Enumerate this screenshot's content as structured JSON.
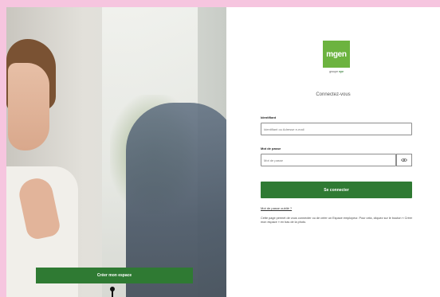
{
  "left_panel": {
    "create_button_label": "Créer mon espace"
  },
  "logo": {
    "text": "mgen",
    "subtitle_prefix": "groupe",
    "subtitle_brand": "vyv"
  },
  "form": {
    "heading": "Connectez-vous",
    "identifier_label": "Identifiant",
    "identifier_placeholder": "Identifiant ou Adresse e-mail",
    "password_label": "Mot de passe",
    "password_placeholder": "Mot de passe",
    "show_password_icon": "eye-icon",
    "login_button_label": "Se connecter",
    "forgot_link": "Mot de passe oublié ?",
    "info_text": "Cette page permet de vous connecter ou de créer un Espace employeur. Pour cela, cliquez sur le bouton « Créer mon espace » en bas de la photo."
  },
  "colors": {
    "page_background": "#f6c5df",
    "brand_green": "#2f7a33",
    "logo_green": "#6cb33f"
  }
}
